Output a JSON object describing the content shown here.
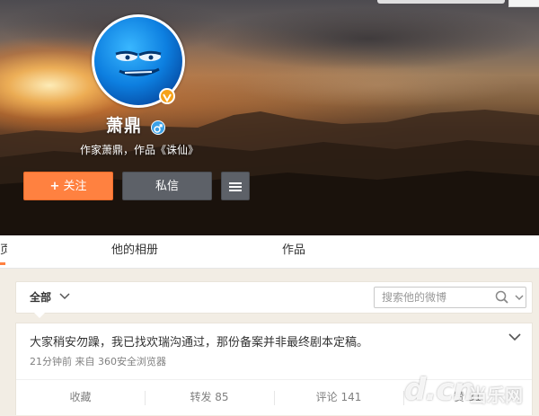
{
  "profile": {
    "name": "萧鼎",
    "bio": "作家萧鼎，作品《诛仙》",
    "follow_label": "关注",
    "follow_plus": "+",
    "message_label": "私信"
  },
  "tabs": [
    {
      "label": "页"
    },
    {
      "label": "他的相册"
    },
    {
      "label": "作品"
    }
  ],
  "filter": {
    "selected": "全部",
    "search_placeholder": "搜索他的微博"
  },
  "post": {
    "text": "大家稍安勿躁，我已找欢瑞沟通过，那份备案并非最终剧本定稿。",
    "meta": "21分钟前 来自 360安全浏览器",
    "actions": {
      "collect": "收藏",
      "repost": "转发 85",
      "comment": "评论 141",
      "like": "赞 81"
    }
  },
  "watermark": {
    "latin": "d.cn",
    "chinese": "当乐网"
  },
  "colors": {
    "follow": "#ff8140",
    "dark_button": "#5d6168",
    "verified_badge": "#f6a21a",
    "gender_male": "#3aa0e6"
  },
  "icons": [
    "verified-badge-icon",
    "male-icon",
    "plus-icon",
    "menu-icon",
    "chevron-down-icon",
    "search-icon",
    "like-icon"
  ]
}
